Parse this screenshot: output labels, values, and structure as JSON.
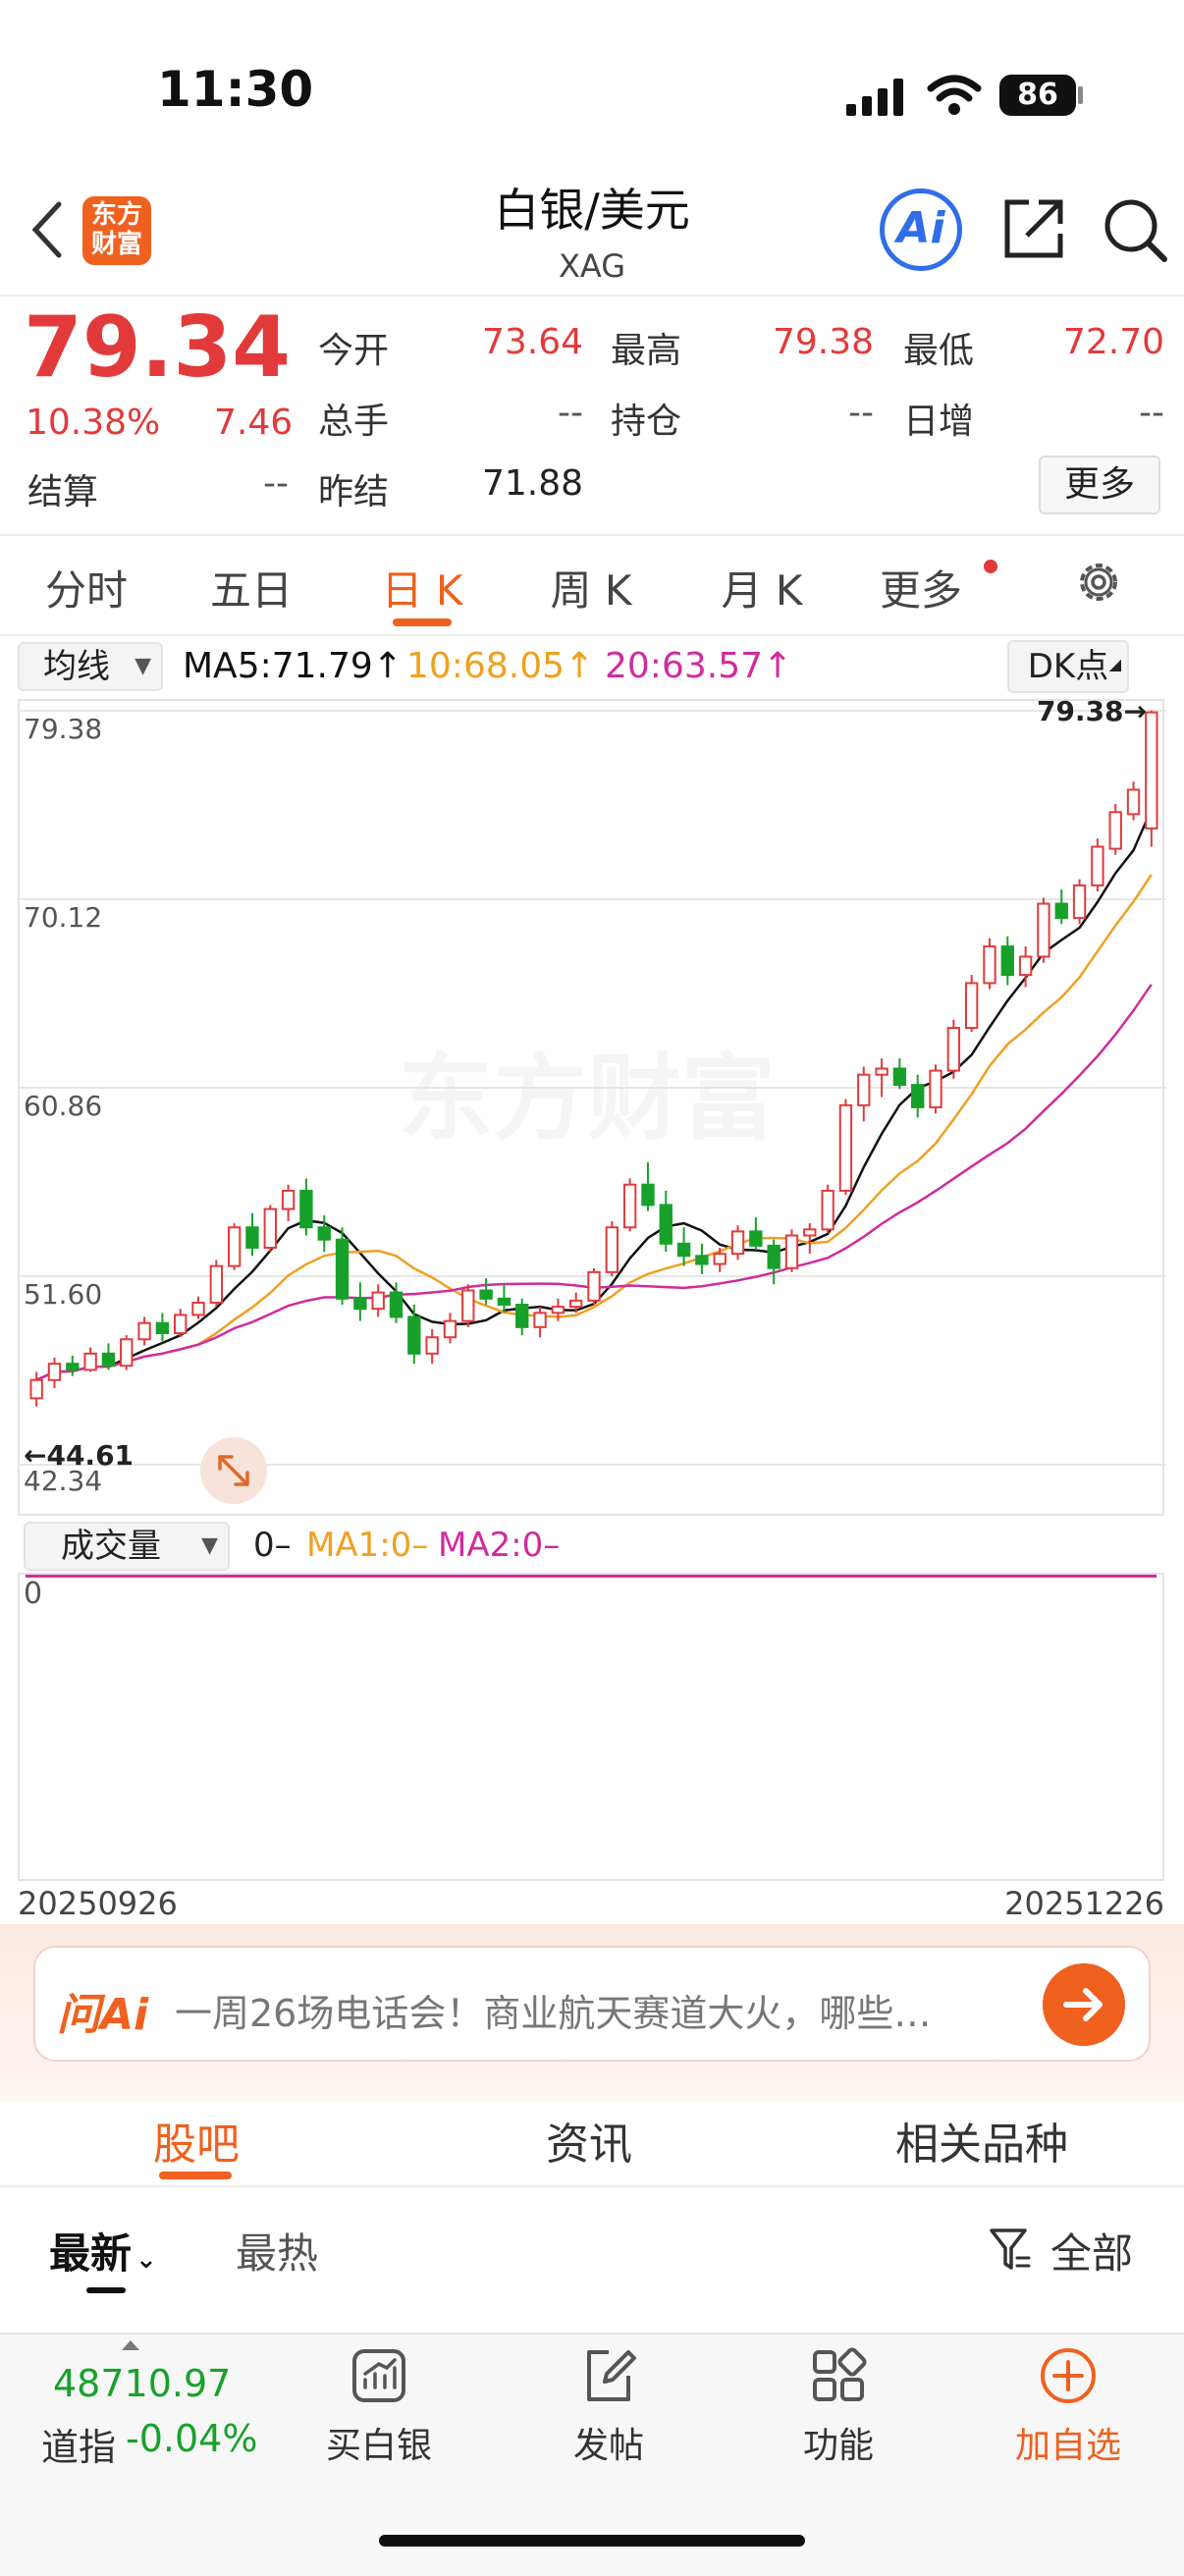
{
  "status_bar": {
    "time": "11:30",
    "battery": "86"
  },
  "header": {
    "logo_line1": "东方",
    "logo_line2": "财富",
    "title": "白银/美元",
    "subtitle": "XAG",
    "ai_label": "Ai"
  },
  "quote": {
    "price": "79.34",
    "change_pct": "10.38%",
    "change_val": "7.46",
    "fields": {
      "open_label": "今开",
      "open": "73.64",
      "high_label": "最高",
      "high": "79.38",
      "low_label": "最低",
      "low": "72.70",
      "volume_label": "总手",
      "volume": "--",
      "position_label": "持仓",
      "position": "--",
      "daily_inc_label": "日增",
      "daily_inc": "--",
      "settle_label": "结算",
      "settle": "--",
      "prev_settle_label": "昨结",
      "prev_settle": "71.88"
    },
    "more_label": "更多"
  },
  "kline_tabs": [
    "分时",
    "五日",
    "日 K",
    "周 K",
    "月 K",
    "更多"
  ],
  "active_tab": "日 K",
  "ma_bar": {
    "select_label": "均线",
    "ma5": "MA5:71.79↑",
    "ma10": "10:68.05↑",
    "ma20": "20:63.57↑",
    "dk_label": "DK点"
  },
  "chart_data": {
    "type": "candlestick",
    "y_ticks": [
      "79.38",
      "70.12",
      "60.86",
      "51.60",
      "42.34"
    ],
    "ylim": [
      42.34,
      79.38
    ],
    "grid": true,
    "max_marker": "79.38→",
    "min_marker": "←44.61",
    "watermark": "东方财富",
    "x_start": "20250926",
    "x_end": "20251226",
    "candles": [
      [
        45.6,
        46.9,
        45.2,
        46.5
      ],
      [
        46.5,
        47.6,
        46.1,
        47.3
      ],
      [
        47.3,
        47.7,
        46.7,
        47.0
      ],
      [
        47.0,
        48.1,
        46.9,
        47.8
      ],
      [
        47.8,
        48.3,
        47.0,
        47.2
      ],
      [
        47.2,
        48.7,
        47.0,
        48.5
      ],
      [
        48.5,
        49.6,
        48.2,
        49.3
      ],
      [
        49.3,
        49.8,
        48.4,
        48.8
      ],
      [
        48.8,
        50.0,
        48.6,
        49.7
      ],
      [
        49.7,
        50.6,
        49.5,
        50.3
      ],
      [
        50.3,
        52.4,
        50.1,
        52.1
      ],
      [
        52.1,
        54.2,
        51.9,
        54.0
      ],
      [
        54.0,
        54.7,
        52.6,
        53.0
      ],
      [
        53.0,
        55.1,
        52.8,
        54.9
      ],
      [
        54.9,
        56.1,
        54.3,
        55.8
      ],
      [
        55.8,
        56.4,
        53.6,
        54.0
      ],
      [
        54.0,
        54.6,
        52.8,
        53.4
      ],
      [
        53.4,
        54.0,
        50.2,
        50.5
      ],
      [
        50.5,
        51.3,
        49.4,
        50.0
      ],
      [
        50.0,
        51.2,
        49.6,
        50.8
      ],
      [
        50.8,
        51.3,
        49.3,
        49.6
      ],
      [
        49.6,
        50.2,
        47.3,
        47.8
      ],
      [
        47.8,
        49.0,
        47.3,
        48.6
      ],
      [
        48.6,
        49.8,
        48.3,
        49.4
      ],
      [
        49.4,
        51.2,
        49.1,
        50.9
      ],
      [
        50.9,
        51.5,
        50.2,
        50.5
      ],
      [
        50.5,
        51.2,
        49.8,
        50.2
      ],
      [
        50.2,
        50.5,
        48.7,
        49.1
      ],
      [
        49.1,
        50.1,
        48.6,
        49.8
      ],
      [
        49.8,
        50.5,
        49.4,
        50.1
      ],
      [
        50.1,
        50.8,
        49.8,
        50.4
      ],
      [
        50.4,
        52.0,
        50.2,
        51.8
      ],
      [
        51.8,
        54.3,
        51.6,
        54.0
      ],
      [
        54.0,
        56.4,
        53.8,
        56.1
      ],
      [
        56.1,
        57.2,
        54.8,
        55.1
      ],
      [
        55.1,
        55.8,
        52.8,
        53.2
      ],
      [
        53.2,
        54.0,
        52.1,
        52.6
      ],
      [
        52.6,
        53.2,
        51.7,
        52.2
      ],
      [
        52.2,
        53.0,
        51.8,
        52.7
      ],
      [
        52.7,
        54.1,
        52.4,
        53.8
      ],
      [
        53.8,
        54.5,
        52.9,
        53.1
      ],
      [
        53.1,
        53.4,
        51.2,
        52.0
      ],
      [
        52.0,
        53.9,
        51.8,
        53.6
      ],
      [
        53.6,
        54.2,
        52.7,
        53.9
      ],
      [
        53.9,
        56.1,
        53.7,
        55.8
      ],
      [
        55.8,
        60.3,
        55.6,
        60.0
      ],
      [
        60.0,
        61.9,
        59.2,
        61.5
      ],
      [
        61.5,
        62.3,
        60.4,
        61.8
      ],
      [
        61.8,
        62.3,
        60.8,
        61.0
      ],
      [
        61.0,
        61.5,
        59.4,
        59.9
      ],
      [
        59.9,
        62.0,
        59.6,
        61.7
      ],
      [
        61.7,
        64.2,
        61.3,
        63.8
      ],
      [
        63.8,
        66.4,
        63.6,
        66.0
      ],
      [
        66.0,
        68.2,
        65.7,
        67.8
      ],
      [
        67.8,
        68.3,
        65.9,
        66.4
      ],
      [
        66.4,
        67.8,
        65.8,
        67.3
      ],
      [
        67.3,
        70.2,
        67.0,
        69.9
      ],
      [
        69.9,
        70.6,
        68.9,
        69.2
      ],
      [
        69.2,
        71.1,
        68.9,
        70.8
      ],
      [
        70.8,
        73.1,
        70.5,
        72.7
      ],
      [
        72.6,
        74.8,
        72.3,
        74.4
      ],
      [
        74.3,
        75.9,
        74.0,
        75.5
      ],
      [
        73.6,
        79.4,
        72.7,
        79.3
      ]
    ]
  },
  "volume": {
    "select_label": "成交量",
    "value": "0–",
    "ma1": "MA1:0–",
    "ma2": "MA2:0–",
    "zero_tick": "0"
  },
  "ai_bar": {
    "logo": "问Ai",
    "prompt": "一周26场电话会！商业航天赛道大火，哪些…"
  },
  "content_tabs": [
    "股吧",
    "资讯",
    "相关品种"
  ],
  "sort": {
    "latest": "最新",
    "hot": "最热",
    "filter": "全部"
  },
  "bottom_bar": {
    "index_value": "48710.97",
    "index_name": "道指",
    "index_change": "-0.04%",
    "items": [
      "买白银",
      "发帖",
      "功能",
      "加自选"
    ]
  },
  "colors": {
    "up": "#e23a3a",
    "down": "#17a12a",
    "ma5": "#111111",
    "ma10": "#f0a020",
    "ma20": "#d12b9c",
    "accent": "#f0601e"
  }
}
